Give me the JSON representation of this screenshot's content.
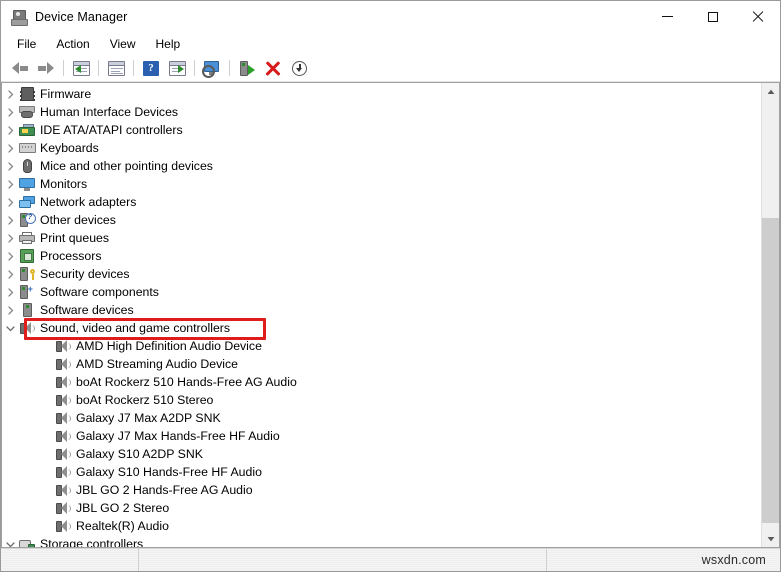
{
  "window": {
    "title": "Device Manager",
    "icon": "device-manager-icon",
    "controls": {
      "minimize": "–",
      "maximize": "□",
      "close": "✕"
    }
  },
  "menu": {
    "items": [
      "File",
      "Action",
      "View",
      "Help"
    ]
  },
  "toolbar": {
    "items": [
      {
        "name": "back-button",
        "icon": "back-arrow-icon"
      },
      {
        "name": "forward-button",
        "icon": "forward-arrow-icon"
      },
      {
        "name": "separator-1",
        "icon": "separator"
      },
      {
        "name": "properties-button",
        "icon": "properties-icon"
      },
      {
        "name": "separator-2",
        "icon": "separator"
      },
      {
        "name": "update-driver-button",
        "icon": "update-driver-icon"
      },
      {
        "name": "separator-3",
        "icon": "separator"
      },
      {
        "name": "help-button",
        "icon": "help-icon",
        "glyph": "?"
      },
      {
        "name": "scan-hardware-changes-button",
        "icon": "scan-changes-icon"
      },
      {
        "name": "separator-4",
        "icon": "separator"
      },
      {
        "name": "show-hidden-devices-button",
        "icon": "monitor-scan-icon"
      },
      {
        "name": "separator-5",
        "icon": "separator"
      },
      {
        "name": "enable-device-button",
        "icon": "enable-device-icon"
      },
      {
        "name": "uninstall-device-button",
        "icon": "red-x-icon"
      },
      {
        "name": "install-legacy-hardware-button",
        "icon": "download-arrow-icon"
      }
    ]
  },
  "tree": {
    "nodes": [
      {
        "label": "Firmware",
        "icon": "chip-icon",
        "level": 0,
        "expanded": false
      },
      {
        "label": "Human Interface Devices",
        "icon": "hid-icon",
        "level": 0,
        "expanded": false
      },
      {
        "label": "IDE ATA/ATAPI controllers",
        "icon": "ide-controller-icon",
        "level": 0,
        "expanded": false
      },
      {
        "label": "Keyboards",
        "icon": "keyboard-icon",
        "level": 0,
        "expanded": false
      },
      {
        "label": "Mice and other pointing devices",
        "icon": "mouse-icon",
        "level": 0,
        "expanded": false
      },
      {
        "label": "Monitors",
        "icon": "monitor-icon",
        "level": 0,
        "expanded": false
      },
      {
        "label": "Network adapters",
        "icon": "network-adapter-icon",
        "level": 0,
        "expanded": false
      },
      {
        "label": "Other devices",
        "icon": "other-device-icon",
        "level": 0,
        "expanded": false
      },
      {
        "label": "Print queues",
        "icon": "printer-icon",
        "level": 0,
        "expanded": false
      },
      {
        "label": "Processors",
        "icon": "processor-icon",
        "level": 0,
        "expanded": false
      },
      {
        "label": "Security devices",
        "icon": "security-device-icon",
        "level": 0,
        "expanded": false
      },
      {
        "label": "Software components",
        "icon": "software-component-icon",
        "level": 0,
        "expanded": false
      },
      {
        "label": "Software devices",
        "icon": "software-device-icon",
        "level": 0,
        "expanded": false
      },
      {
        "label": "Sound, video and game controllers",
        "icon": "speaker-icon",
        "level": 0,
        "expanded": true,
        "highlighted": true
      },
      {
        "label": "AMD High Definition Audio Device",
        "icon": "speaker-icon",
        "level": 1
      },
      {
        "label": "AMD Streaming Audio Device",
        "icon": "speaker-icon",
        "level": 1
      },
      {
        "label": "boAt Rockerz 510 Hands-Free AG Audio",
        "icon": "speaker-icon",
        "level": 1
      },
      {
        "label": "boAt Rockerz 510 Stereo",
        "icon": "speaker-icon",
        "level": 1
      },
      {
        "label": "Galaxy J7 Max A2DP SNK",
        "icon": "speaker-icon",
        "level": 1
      },
      {
        "label": "Galaxy J7 Max Hands-Free HF Audio",
        "icon": "speaker-icon",
        "level": 1
      },
      {
        "label": "Galaxy S10 A2DP SNK",
        "icon": "speaker-icon",
        "level": 1
      },
      {
        "label": "Galaxy S10 Hands-Free HF Audio",
        "icon": "speaker-icon",
        "level": 1
      },
      {
        "label": "JBL GO 2 Hands-Free AG Audio",
        "icon": "speaker-icon",
        "level": 1
      },
      {
        "label": "JBL GO 2 Stereo",
        "icon": "speaker-icon",
        "level": 1
      },
      {
        "label": "Realtek(R) Audio",
        "icon": "speaker-icon",
        "level": 1
      },
      {
        "label": "Storage controllers",
        "icon": "storage-controller-icon",
        "level": 0,
        "expanded": true
      }
    ]
  },
  "highlight": {
    "color": "#e01b1b",
    "target": "Sound, video and game controllers"
  },
  "scrollbar": {
    "up_glyph": "▲",
    "down_glyph": "▼"
  },
  "statusbar": {
    "pane1": "",
    "pane2": "",
    "watermark": "wsxdn.com"
  }
}
